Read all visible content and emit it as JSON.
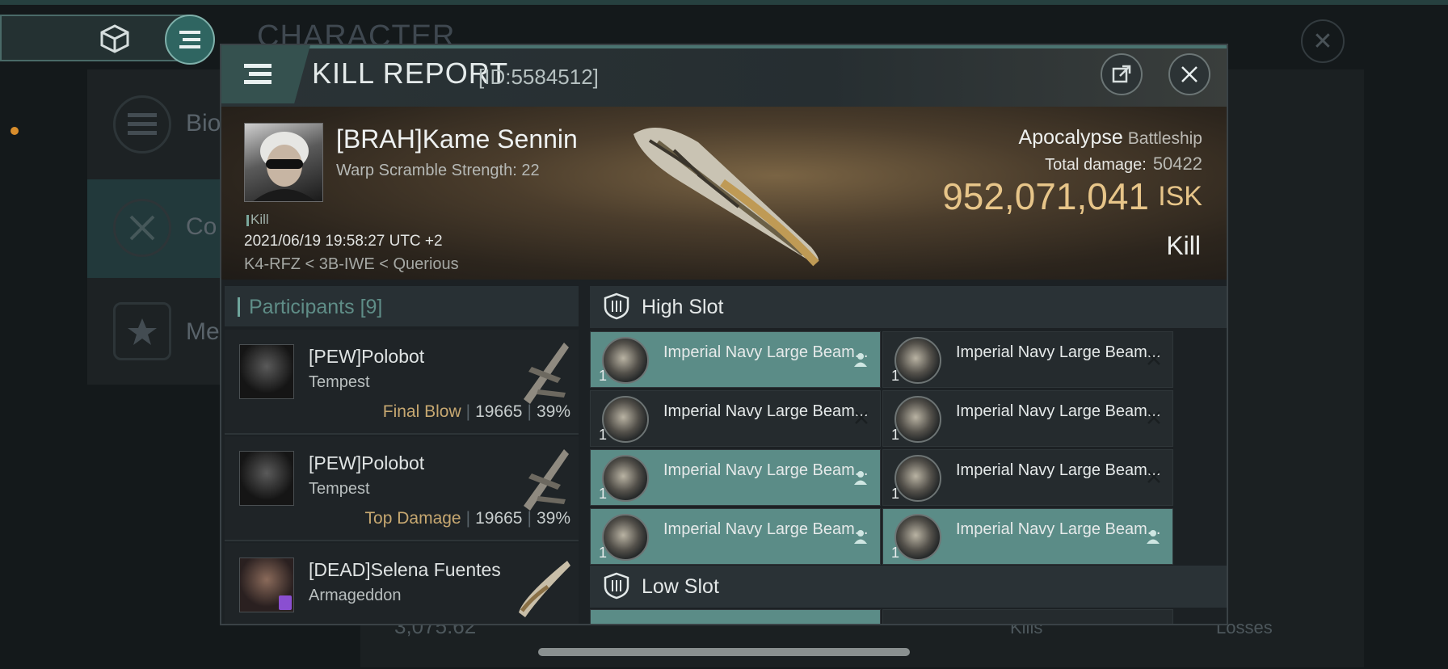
{
  "background": {
    "title": "CHARACTER",
    "menu_items": [
      {
        "label": "Bio",
        "icon": "list-icon"
      },
      {
        "label": "Co",
        "icon": "crossed-swords-icon"
      },
      {
        "label": "Me",
        "icon": "star-icon"
      }
    ],
    "balance": "3,075.62",
    "kills_label": "Kills",
    "losses_label": "Losses"
  },
  "modal": {
    "title": "KILL REPORT",
    "id": "[ID:5584512]",
    "victim": {
      "name": "[BRAH]Kame Sennin",
      "warp_scramble": "Warp Scramble Strength: 22",
      "kill_tag": "Kill",
      "datetime": "2021/06/19 19:58:27 UTC +2",
      "location": "K4-RFZ < 3B-IWE < Querious"
    },
    "ship": {
      "name": "Apocalypse",
      "class": "Battleship",
      "total_damage_label": "Total damage:",
      "total_damage": "50422",
      "isk_value": "952,071,041",
      "isk_unit": "ISK",
      "result": "Kill"
    },
    "participants": {
      "label": "Participants",
      "count": "[9]",
      "items": [
        {
          "name": "[PEW]Polobot",
          "ship": "Tempest",
          "role": "Final Blow",
          "damage": "19665",
          "percent": "39%"
        },
        {
          "name": "[PEW]Polobot",
          "ship": "Tempest",
          "role": "Top Damage",
          "damage": "19665",
          "percent": "39%"
        },
        {
          "name": "[DEAD]Selena Fuentes",
          "ship": "Armageddon",
          "role": "",
          "damage": "",
          "percent": ""
        }
      ]
    },
    "fitting": {
      "high_slot_label": "High Slot",
      "low_slot_label": "Low Slot",
      "high_modules": [
        {
          "name": "Imperial Navy Large Beam...",
          "qty": "1",
          "state": "dropped"
        },
        {
          "name": "Imperial Navy Large Beam...",
          "qty": "1",
          "state": "destroyed"
        },
        {
          "name": "Imperial Navy Large Beam...",
          "qty": "1",
          "state": "destroyed"
        },
        {
          "name": "Imperial Navy Large Beam...",
          "qty": "1",
          "state": "destroyed"
        },
        {
          "name": "Imperial Navy Large Beam...",
          "qty": "1",
          "state": "dropped"
        },
        {
          "name": "Imperial Navy Large Beam...",
          "qty": "1",
          "state": "destroyed"
        },
        {
          "name": "Imperial Navy Large Beam...",
          "qty": "1",
          "state": "dropped"
        },
        {
          "name": "Imperial Navy Large Beam...",
          "qty": "1",
          "state": "dropped"
        }
      ]
    }
  },
  "colors": {
    "accent": "#5b8c87",
    "isk": "#e7c589",
    "role": "#c7a871"
  }
}
